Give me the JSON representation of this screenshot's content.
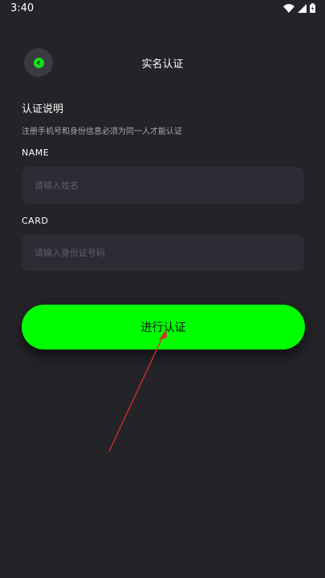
{
  "status_bar": {
    "time": "3:40",
    "icons": [
      "wifi-icon",
      "signal-icon",
      "battery-icon"
    ]
  },
  "header": {
    "title": "实名认证",
    "back_icon": "chevron-left-icon"
  },
  "intro": {
    "title": "认证说明",
    "description": "注册手机号和身份信息必须为同一人才能认证"
  },
  "form": {
    "name_label": "NAME",
    "name_placeholder": "请输入姓名",
    "name_value": "",
    "card_label": "CARD",
    "card_placeholder": "请输入身份证号码",
    "card_value": ""
  },
  "submit": {
    "label": "进行认证"
  },
  "colors": {
    "background": "#232328",
    "accent": "#00ff00",
    "input_background": "#2c2c34",
    "annotation": "#e02a2a"
  }
}
